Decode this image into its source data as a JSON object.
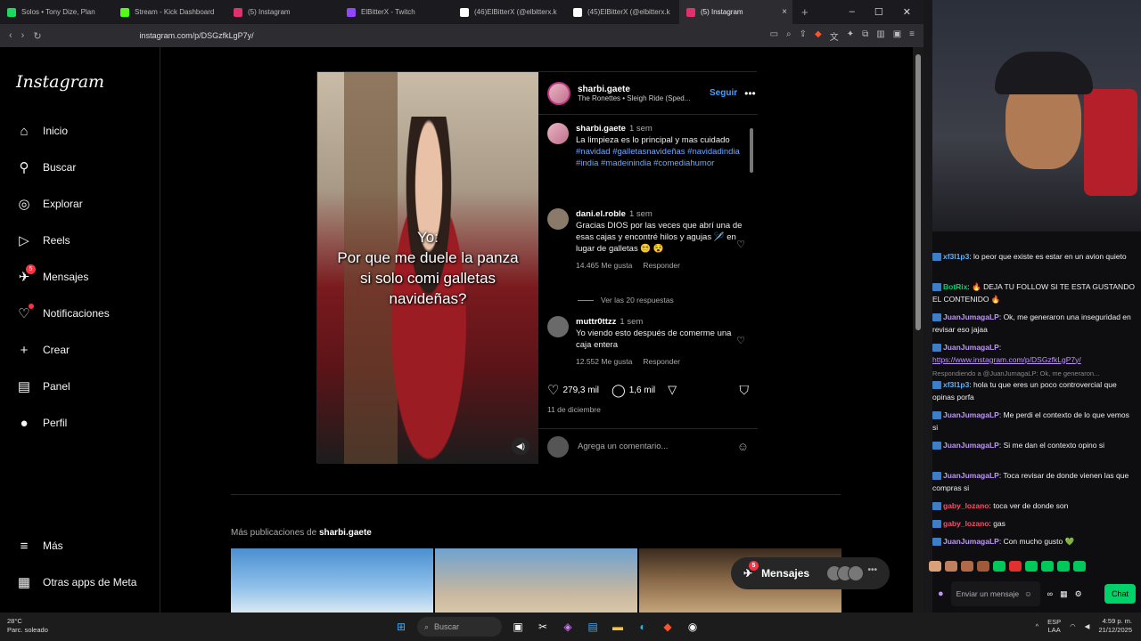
{
  "browser": {
    "tabs": [
      {
        "label": "Solos • Tony Dize, Plan",
        "color": "#1ed760"
      },
      {
        "label": "Stream - Kick Dashboard",
        "color": "#53fc18"
      },
      {
        "label": "(5) Instagram",
        "color": "#e1306c"
      },
      {
        "label": "ElBitterX - Twitch",
        "color": "#9146ff"
      },
      {
        "label": "(46)ElBitterX (@elbitterx.k",
        "color": "#ffffff"
      },
      {
        "label": "(45)ElBitterX (@elbitterx.k",
        "color": "#ffffff"
      },
      {
        "label": "(5) Instagram",
        "color": "#e1306c"
      }
    ],
    "active_tab_close": "×",
    "new_tab": "+",
    "url": "instagram.com/p/DSGzfkLgP7y/",
    "minimize": "–",
    "maximize": "☐",
    "close": "✕"
  },
  "instagram": {
    "logo": "Instagram",
    "nav": [
      {
        "label": "Inicio",
        "icon": "home-icon",
        "glyph": "⌂"
      },
      {
        "label": "Buscar",
        "icon": "search-icon",
        "glyph": "⚲"
      },
      {
        "label": "Explorar",
        "icon": "compass-icon",
        "glyph": "◎"
      },
      {
        "label": "Reels",
        "icon": "reels-icon",
        "glyph": "▷"
      },
      {
        "label": "Mensajes",
        "icon": "messages-icon",
        "glyph": "✈",
        "badge": "5"
      },
      {
        "label": "Notificaciones",
        "icon": "heart-icon",
        "glyph": "♡"
      },
      {
        "label": "Crear",
        "icon": "plus-icon",
        "glyph": "+"
      },
      {
        "label": "Panel",
        "icon": "dashboard-icon",
        "glyph": "▤"
      },
      {
        "label": "Perfil",
        "icon": "profile-icon",
        "glyph": "●"
      }
    ],
    "more": "Más",
    "meta_apps": "Otras apps de Meta",
    "post": {
      "video_text_1": "Yo:",
      "video_text_2": "Por que me duele la panza si solo comi galletas navideñas?",
      "author": "sharbi.gaete",
      "song": "The Ronettes • Sleigh Ride (Sped...",
      "follow": "Seguir",
      "caption_author": "sharbi.gaete",
      "caption_time": "1 sem",
      "caption": "La limpieza es lo principal y mas cuidado",
      "hashtags": "#navidad #galletasnavideñas #navidadindia #india #madeinindia #comediahumor",
      "comments": [
        {
          "user": "dani.el.roble",
          "time": "1 sem",
          "text": "Gracias DIOS por las veces que abrí una de esas cajas y encontré hilos y agujas 🪡 en lugar de galletas 😵‍💫 😵",
          "likes": "14.465 Me gusta",
          "reply": "Responder",
          "view_replies": "Ver las 20 respuestas"
        },
        {
          "user": "muttr0ttzz",
          "time": "1 sem",
          "text": "Yo viendo esto después de comerme una caja entera",
          "likes": "12.552 Me gusta",
          "reply": "Responder"
        }
      ],
      "likes": "279,3 mil",
      "comment_count": "1,6 mil",
      "date": "11 de diciembre",
      "add_comment": "Agrega un comentario..."
    },
    "more_posts_prefix": "Más publicaciones de",
    "more_posts_user": "sharbi.gaete",
    "messages_pill": "Mensajes",
    "messages_badge": "5"
  },
  "chat": [
    {
      "user": "xf3l1p3",
      "text": "lo peor que existe es estar en un avion quieto",
      "color": "#5bb0ff"
    },
    {
      "user": "BotRix",
      "text": "🔥 DEJA TU FOLLOW SI TE ESTA GUSTANDO EL CONTENIDO 🔥",
      "color": "#00d26a"
    },
    {
      "user": "JuanJumagaLP",
      "text": "Ok, me generaron una inseguridad en revisar eso jajaa",
      "color": "#bf94ff"
    },
    {
      "user": "JuanJumagaLP",
      "text": "",
      "link": "https://www.instagram.com/p/DSGzfkLgP7y/",
      "color": "#bf94ff"
    },
    {
      "reply": "Respondiendo a @JuanJumagaLP: Ok, me generaron..."
    },
    {
      "user": "xf3l1p3",
      "text": "hola tu que eres un poco controvercial que opinas porfa",
      "color": "#5bb0ff"
    },
    {
      "user": "JuanJumagaLP",
      "text": "Me perdi el contexto de lo que vemos si",
      "color": "#bf94ff"
    },
    {
      "user": "JuanJumagaLP",
      "text": "Si me dan el contexto opino si",
      "color": "#bf94ff"
    },
    {
      "user": "JuanJumagaLP",
      "text": "Toca revisar de donde vienen las que compras si",
      "color": "#bf94ff"
    },
    {
      "user": "gaby_lozano",
      "text": "toca ver de donde son",
      "color": "#ff4a6b"
    },
    {
      "user": "gaby_lozano",
      "text": "gas",
      "color": "#ff4a6b"
    },
    {
      "user": "JuanJumagaLP",
      "text": "Con mucho gusto 💚",
      "color": "#bf94ff"
    }
  ],
  "chat_input": "Enviar un mensaje",
  "chat_button": "Chat",
  "taskbar": {
    "temp": "28°C",
    "weather": "Parc. soleado",
    "search": "Buscar",
    "lang": "ESP",
    "lang2": "LAA",
    "time": "4:59 p. m.",
    "date": "21/12/2025"
  }
}
